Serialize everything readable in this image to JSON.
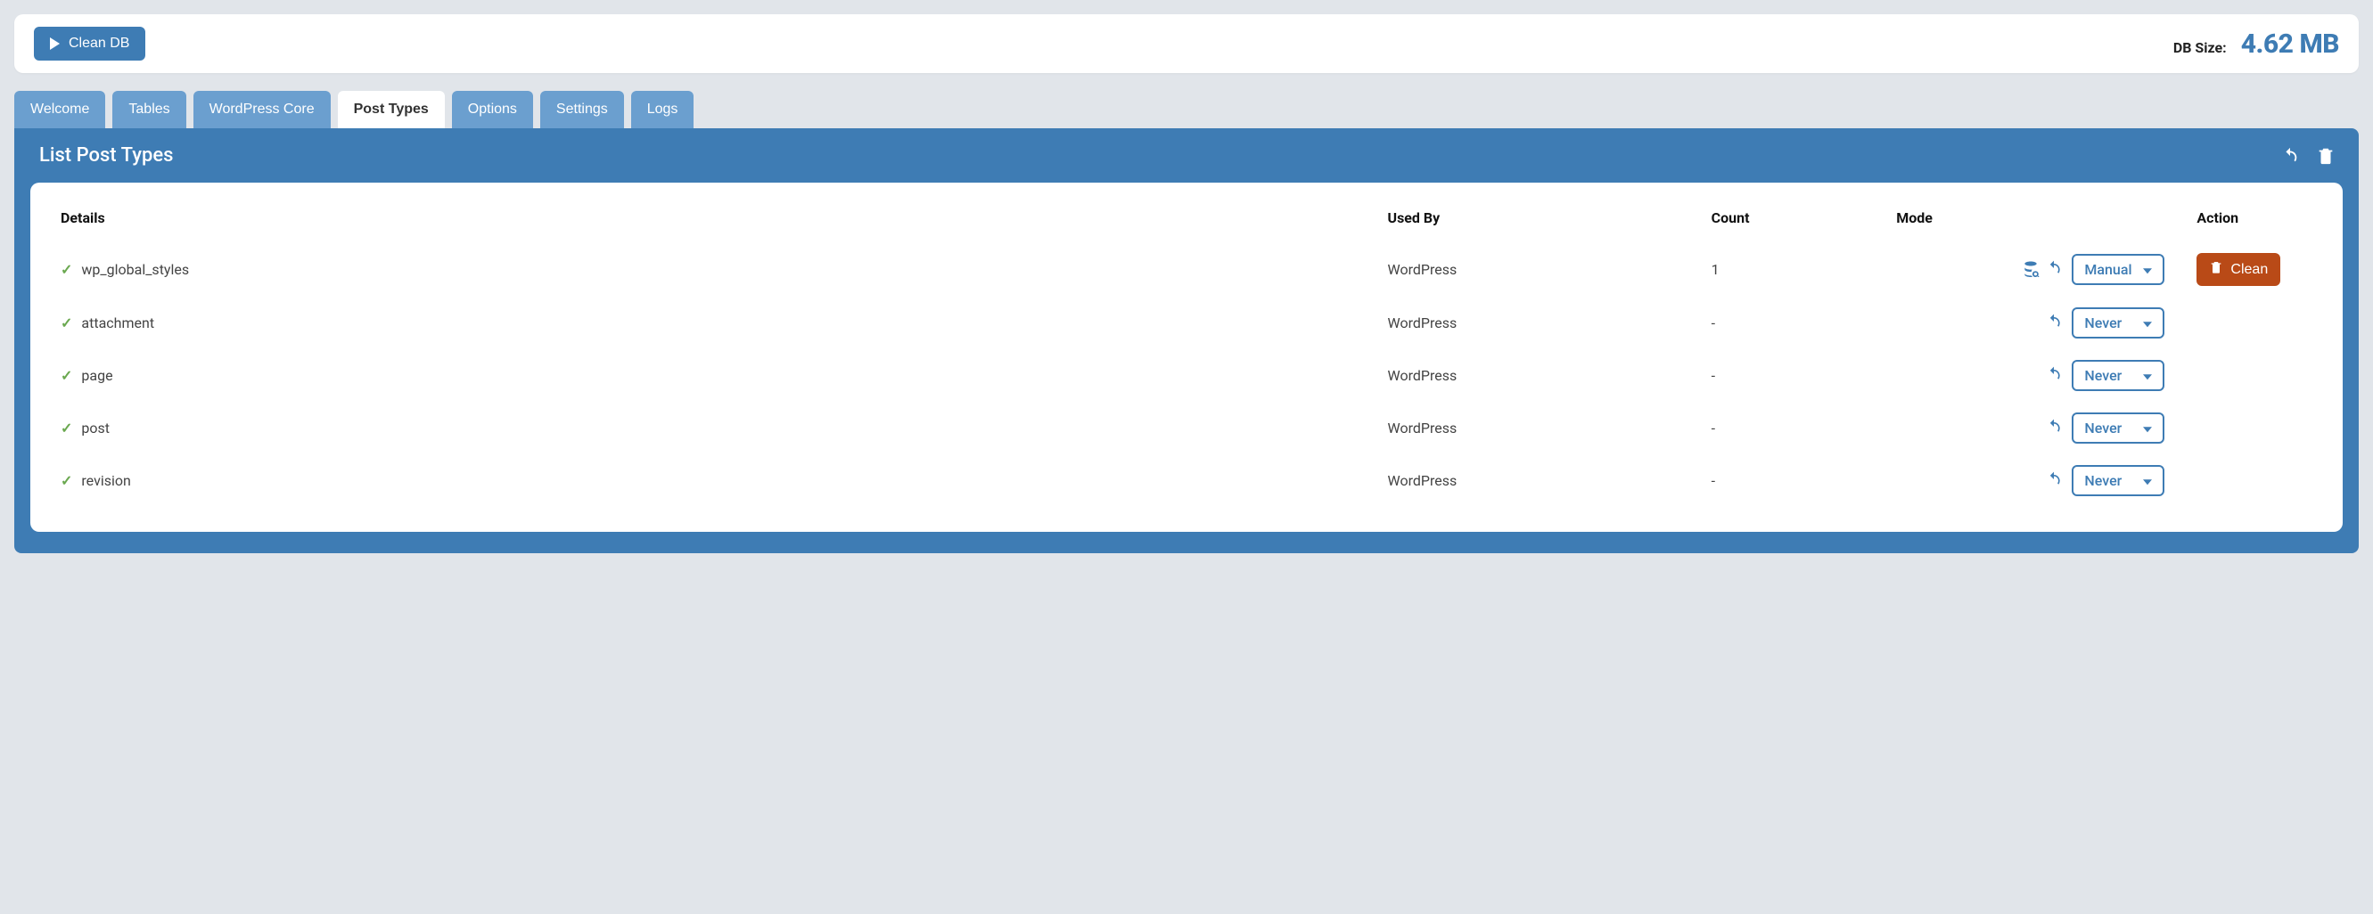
{
  "topbar": {
    "clean_db_label": "Clean DB",
    "db_size_label": "DB Size:",
    "db_size_value": "4.62 MB"
  },
  "tabs": [
    {
      "label": "Welcome",
      "active": false
    },
    {
      "label": "Tables",
      "active": false
    },
    {
      "label": "WordPress Core",
      "active": false
    },
    {
      "label": "Post Types",
      "active": true
    },
    {
      "label": "Options",
      "active": false
    },
    {
      "label": "Settings",
      "active": false
    },
    {
      "label": "Logs",
      "active": false
    }
  ],
  "panel": {
    "title": "List Post Types",
    "columns": {
      "details": "Details",
      "used_by": "Used By",
      "count": "Count",
      "mode": "Mode",
      "action": "Action"
    },
    "clean_label": "Clean",
    "rows": [
      {
        "name": "wp_global_styles",
        "used_by": "WordPress",
        "count": "1",
        "mode": "Manual",
        "show_inspect": true,
        "show_refresh": true,
        "show_clean": true
      },
      {
        "name": "attachment",
        "used_by": "WordPress",
        "count": "-",
        "mode": "Never",
        "show_inspect": false,
        "show_refresh": true,
        "show_clean": false
      },
      {
        "name": "page",
        "used_by": "WordPress",
        "count": "-",
        "mode": "Never",
        "show_inspect": false,
        "show_refresh": true,
        "show_clean": false
      },
      {
        "name": "post",
        "used_by": "WordPress",
        "count": "-",
        "mode": "Never",
        "show_inspect": false,
        "show_refresh": true,
        "show_clean": false
      },
      {
        "name": "revision",
        "used_by": "WordPress",
        "count": "-",
        "mode": "Never",
        "show_inspect": false,
        "show_refresh": true,
        "show_clean": false
      }
    ]
  }
}
